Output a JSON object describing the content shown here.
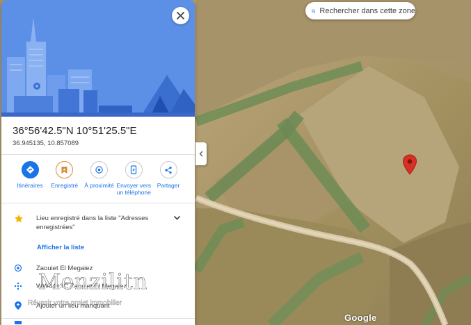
{
  "map": {
    "search_this_area": "Rechercher dans cette zone",
    "attribution": "Google",
    "pin_color": "#d93025"
  },
  "panel": {
    "close_icon": "close-icon",
    "coordinates_dms": "36°56'42.5\"N 10°51'25.5\"E",
    "coordinates_decimal": "36.945135, 10.857089",
    "actions": [
      {
        "label": "Itinéraires",
        "icon": "directions-icon"
      },
      {
        "label": "Enregistré",
        "icon": "bookmark-icon"
      },
      {
        "label": "À proximité",
        "icon": "nearby-icon"
      },
      {
        "label": "Envoyer vers\nun téléphone",
        "icon": "send-to-phone-icon"
      },
      {
        "label": "Partager",
        "icon": "share-icon"
      }
    ],
    "saved_text": "Lieu enregistré dans la liste \"Adresses enregistrées\"",
    "show_list": "Afficher la liste",
    "info_rows": [
      {
        "text": "Zaouiet El Megaiez",
        "icon": "location-icon"
      },
      {
        "text": "WW44+3C Zaouiet El Megaiez",
        "icon": "plus-code-icon"
      },
      {
        "text": "Ajouter un lieu manquant",
        "icon": "add-place-icon"
      }
    ]
  },
  "watermark": {
    "logo": "Menzilitn",
    "tagline": "Réussir votre projet immobilier"
  },
  "colors": {
    "accent": "#1a73e8",
    "hero_sky": "#5c8fe6",
    "star": "#f4b400",
    "saved": "#d98b3a"
  }
}
